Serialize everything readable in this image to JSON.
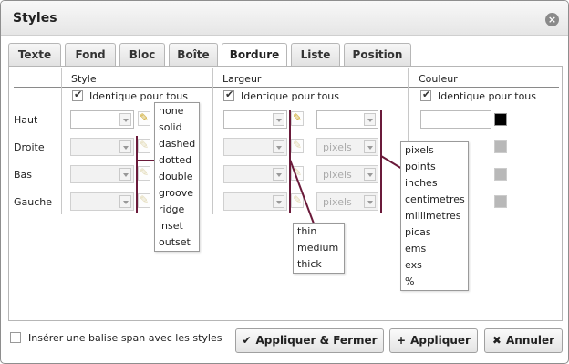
{
  "dialog": {
    "title": "Styles",
    "close_icon": "close-icon"
  },
  "tabs": [
    {
      "label": "Texte"
    },
    {
      "label": "Fond"
    },
    {
      "label": "Bloc"
    },
    {
      "label": "Boîte"
    },
    {
      "label": "Bordure",
      "active": true
    },
    {
      "label": "Liste"
    },
    {
      "label": "Position"
    }
  ],
  "columns": {
    "style": "Style",
    "largeur": "Largeur",
    "couleur": "Couleur"
  },
  "same_for_all": "Identique pour tous",
  "rows": [
    "Haut",
    "Droite",
    "Bas",
    "Gauche"
  ],
  "unit_placeholder": "pixels",
  "style_options": [
    "none",
    "solid",
    "dashed",
    "dotted",
    "double",
    "groove",
    "ridge",
    "inset",
    "outset"
  ],
  "width_options": [
    "thin",
    "medium",
    "thick"
  ],
  "unit_options": [
    "pixels",
    "points",
    "inches",
    "centimetres",
    "millimetres",
    "picas",
    "ems",
    "exs",
    "%"
  ],
  "colors": {
    "swatch_active": "#000000",
    "swatch_disabled": "#b8b8b8",
    "bracket": "#6a1a3a"
  },
  "footer": {
    "span_checkbox_label": "Insérer une balise span avec les styles",
    "apply_close": "Appliquer & Fermer",
    "apply": "Appliquer",
    "cancel": "Annuler"
  }
}
